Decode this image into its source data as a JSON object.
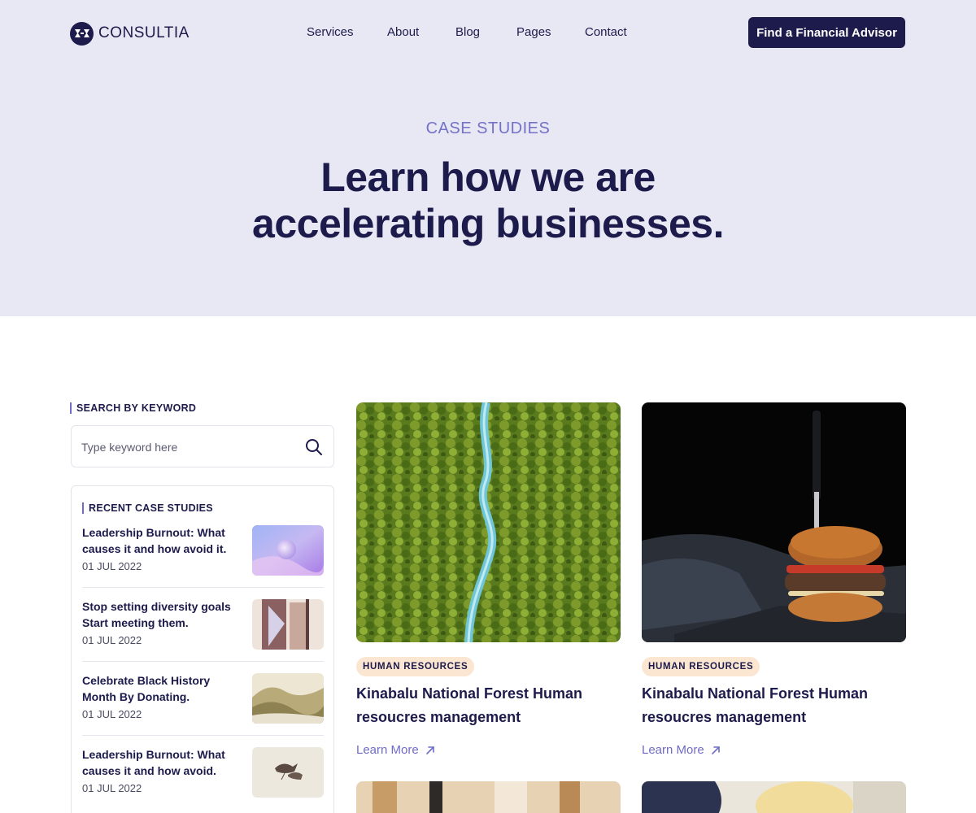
{
  "brand": {
    "name": "CONSULTIA",
    "primary_color": "#1c1b4b",
    "accent_color": "#6f6cc7",
    "hero_bg": "#e8e8f4",
    "tag_bg": "#fbe6d2"
  },
  "nav": {
    "items": [
      "Services",
      "About",
      "Blog",
      "Pages",
      "Contact"
    ],
    "cta": "Find a Financial Advisor"
  },
  "hero": {
    "eyebrow": "CASE STUDIES",
    "title_line1": "Learn how we are",
    "title_line2": "accelerating businesses."
  },
  "sidebar": {
    "search": {
      "label": "SEARCH BY KEYWORD",
      "placeholder": "Type keyword here",
      "icon": "search-icon"
    },
    "recent": {
      "label": "RECENT CASE STUDIES",
      "items": [
        {
          "title": "Leadership Burnout: What causes it and how avoid it.",
          "date": "01 JUL 2022"
        },
        {
          "title": "Stop setting diversity goals Start meeting them.",
          "date": "01 JUL 2022"
        },
        {
          "title": "Celebrate Black History Month By Donating.",
          "date": "01 JUL 2022"
        },
        {
          "title": "Leadership Burnout: What causes it and how avoid.",
          "date": "01 JUL 2022"
        }
      ]
    }
  },
  "cards": [
    {
      "tag": "HUMAN RESOURCES",
      "title": "Kinabalu National Forest Human resoucres management",
      "link": "Learn More",
      "link_icon": "arrow-up-right-icon"
    },
    {
      "tag": "HUMAN RESOURCES",
      "title": "Kinabalu National Forest Human resoucres management",
      "link": "Learn More",
      "link_icon": "arrow-up-right-icon"
    }
  ]
}
